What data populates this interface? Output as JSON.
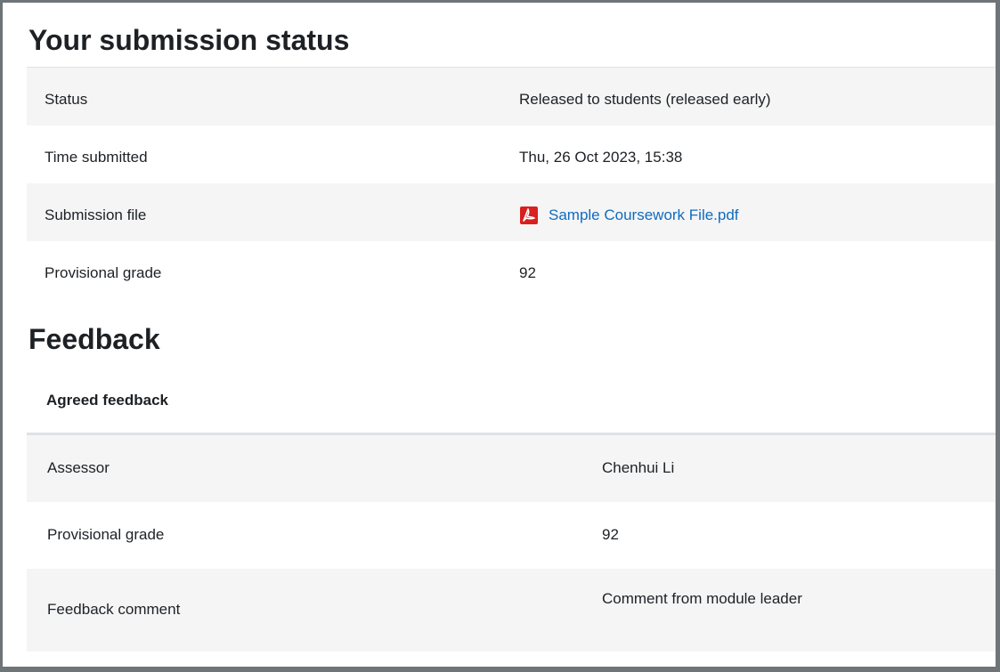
{
  "submission": {
    "title": "Your submission status",
    "rows": [
      {
        "label": "Status",
        "value": "Released to students (released early)"
      },
      {
        "label": "Time submitted",
        "value": "Thu, 26 Oct 2023, 15:38"
      },
      {
        "label": "Submission file",
        "file_name": "Sample Coursework File.pdf",
        "icon": "pdf-file-icon"
      },
      {
        "label": "Provisional grade",
        "value": "92"
      }
    ]
  },
  "feedback": {
    "title": "Feedback",
    "subtitle": "Agreed feedback",
    "rows": [
      {
        "label": "Assessor",
        "value": "Chenhui Li"
      },
      {
        "label": "Provisional grade",
        "value": "92"
      },
      {
        "label": "Feedback comment",
        "value": "Comment from module leader"
      }
    ]
  },
  "colors": {
    "link": "#0f6cbf",
    "stripe": "#f5f5f5",
    "pdf_red": "#d9201f"
  }
}
